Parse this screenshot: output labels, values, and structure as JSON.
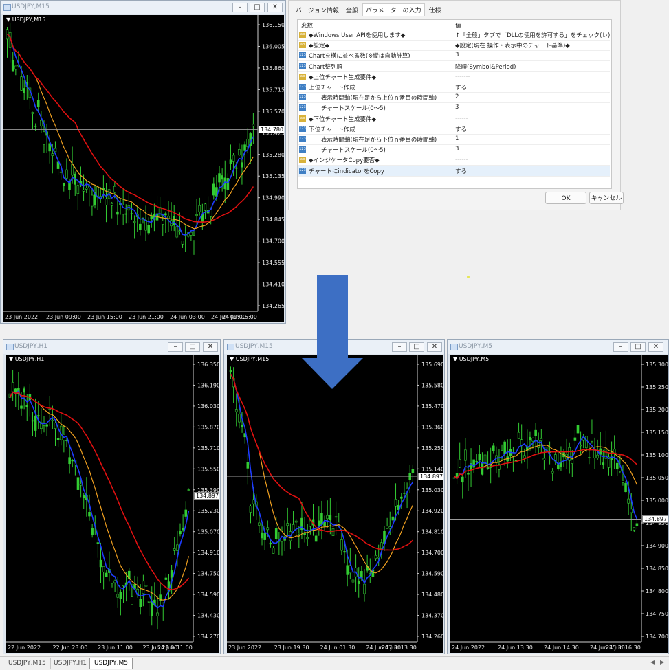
{
  "top_window": {
    "title": "USDJPY,M15",
    "chart_label": "USDJPY,M15",
    "price_ticks": [
      "136.150",
      "136.005",
      "135.860",
      "135.715",
      "135.570",
      "135.425",
      "135.280",
      "135.135",
      "134.990",
      "134.845",
      "134.700",
      "134.555",
      "134.410",
      "134.265"
    ],
    "time_ticks": [
      "23 Jun 2022",
      "23 Jun 09:00",
      "23 Jun 15:00",
      "23 Jun 21:00",
      "24 Jun 03:00",
      "24 Jun 09:00",
      "24 Jun 15:00"
    ],
    "price_marker": "134.780"
  },
  "dialog": {
    "tabs": [
      "バージョン情報",
      "全般",
      "パラメーターの入力",
      "仕様"
    ],
    "active_tab": "パラメーターの入力",
    "col_name": "変数",
    "col_value": "値",
    "rows": [
      {
        "type": "ab",
        "name": "◆Windows User APIを使用します◆",
        "value": "↑「全般」タブで「DLLの使用を許可する」をチェック(レ)してくだ..."
      },
      {
        "type": "ab",
        "name": "◆設定◆",
        "value": "◆設定(現在 操作・表示中のチャート基準)◆"
      },
      {
        "type": "n",
        "name": "Chartを横に並べる数(※縦は自動計算)",
        "value": "3"
      },
      {
        "type": "n",
        "name": "Chart整列順",
        "value": "降順(Symbol&Period)"
      },
      {
        "type": "ab",
        "name": "◆上位チャート生成要件◆",
        "value": "-------"
      },
      {
        "type": "n",
        "name": "上位チャート作成",
        "value": "する"
      },
      {
        "type": "n",
        "name": "表示時間軸(現在足から上位ｎ番目の時間軸)",
        "value": "2"
      },
      {
        "type": "n",
        "name": "チャートスケール(0～5)",
        "value": "3"
      },
      {
        "type": "ab",
        "name": "◆下位チャート生成要件◆",
        "value": "------"
      },
      {
        "type": "n",
        "name": "下位チャート作成",
        "value": "する"
      },
      {
        "type": "n",
        "name": "表示時間軸(現在足から下位ｎ番目の時間軸)",
        "value": "1"
      },
      {
        "type": "n",
        "name": "チャートスケール(0～5)",
        "value": "3"
      },
      {
        "type": "ab",
        "name": "◆インジケータCopy要否◆",
        "value": "------"
      },
      {
        "type": "n",
        "name": "チャートにindicatorをCopy",
        "value": "する"
      }
    ],
    "ok_label": "OK",
    "cancel_label": "キャンセル"
  },
  "bottom_windows": [
    {
      "title": "USDJPY,H1",
      "chart_label": "USDJPY,H1",
      "price_ticks": [
        "136.350",
        "136.190",
        "136.030",
        "135.870",
        "135.710",
        "135.550",
        "135.390",
        "135.230",
        "135.070",
        "134.910",
        "134.750",
        "134.590",
        "134.430",
        "134.270"
      ],
      "time_ticks": [
        "22 Jun 2022",
        "22 Jun 23:00",
        "23 Jun 11:00",
        "23 Jun 23:00",
        "24 Jun 11:00"
      ],
      "price_marker": "134.897"
    },
    {
      "title": "USDJPY,M15",
      "chart_label": "USDJPY,M15",
      "price_ticks": [
        "135.690",
        "135.580",
        "135.470",
        "135.360",
        "135.250",
        "135.140",
        "135.030",
        "134.920",
        "134.810",
        "134.700",
        "134.590",
        "134.480",
        "134.370",
        "134.260"
      ],
      "time_ticks": [
        "23 Jun 2022",
        "23 Jun 19:30",
        "24 Jun 01:30",
        "24 Jun 07:30",
        "24 Jun 13:30"
      ],
      "price_marker": "134.897"
    },
    {
      "title": "USDJPY,M5",
      "chart_label": "USDJPY,M5",
      "price_ticks": [
        "135.300",
        "135.250",
        "135.200",
        "135.150",
        "135.100",
        "135.050",
        "135.000",
        "134.950",
        "134.900",
        "134.850",
        "134.800",
        "134.750",
        "134.700"
      ],
      "time_ticks": [
        "24 Jun 2022",
        "24 Jun 13:30",
        "24 Jun 14:30",
        "24 Jun 15:30",
        "24 Jun 16:30"
      ],
      "price_marker": "134.897"
    }
  ],
  "bottom_tabs": [
    "USDJPY,M15",
    "USDJPY,H1",
    "USDJPY,M5"
  ],
  "active_bottom_tab": "USDJPY,M5",
  "colors": {
    "candle": "#33cc33",
    "ma_fast": "#1e3cff",
    "ma_mid": "#f0a020",
    "ma_slow": "#e01010",
    "arrow": "#3d6fc4"
  }
}
